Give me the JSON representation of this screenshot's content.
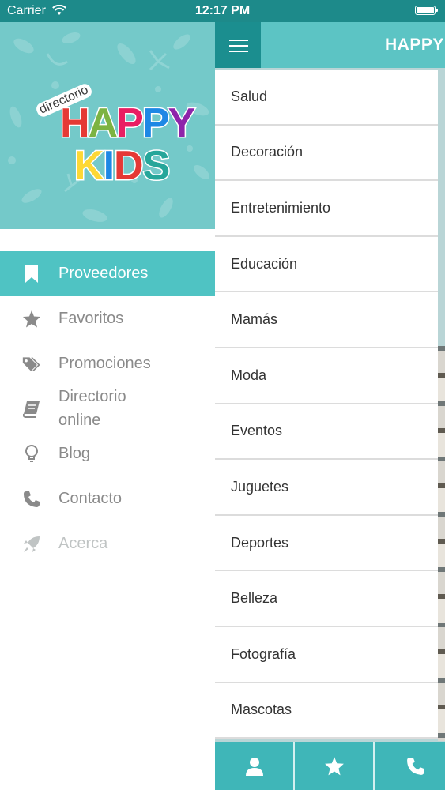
{
  "status_bar": {
    "carrier": "Carrier",
    "time": "12:17 PM"
  },
  "drawer": {
    "logo": {
      "small_text": "directorio",
      "word1": "HAPPY",
      "word2": "KIDS",
      "word1_colors": [
        "#e53935",
        "#7cb342",
        "#e91e63",
        "#1e88e5",
        "#8e24aa"
      ],
      "word2_colors": [
        "#fdd835",
        "#1e88e5",
        "#e53935",
        "#26a69a"
      ]
    },
    "items": [
      {
        "label": "Proveedores",
        "icon": "bookmark-icon",
        "active": true
      },
      {
        "label": "Favoritos",
        "icon": "star-icon",
        "active": false
      },
      {
        "label": "Promociones",
        "icon": "tags-icon",
        "active": false
      },
      {
        "label": "Directorio online",
        "icon": "book-icon",
        "active": false
      },
      {
        "label": "Blog",
        "icon": "lightbulb-icon",
        "active": false
      },
      {
        "label": "Contacto",
        "icon": "phone-icon",
        "active": false
      },
      {
        "label": "Acerca",
        "icon": "rocket-icon",
        "active": false
      }
    ]
  },
  "main": {
    "title": "HAPPY",
    "categories": [
      "Salud",
      "Decoración",
      "Entretenimiento",
      "Educación",
      "Mamás",
      "Moda",
      "Eventos",
      "Juguetes",
      "Deportes",
      "Belleza",
      "Fotografía",
      "Mascotas"
    ],
    "tabs": [
      {
        "icon": "user-icon"
      },
      {
        "icon": "star-icon"
      },
      {
        "icon": "phone-icon"
      }
    ]
  },
  "colors": {
    "status_bar": "#1d8a8a",
    "accent": "#4fc3c3",
    "topbar": "#5cc4c4",
    "hamburger_bg": "#1b8e8f",
    "tabbar": "#3fb6b8",
    "header_bg": "#74c9c9"
  }
}
